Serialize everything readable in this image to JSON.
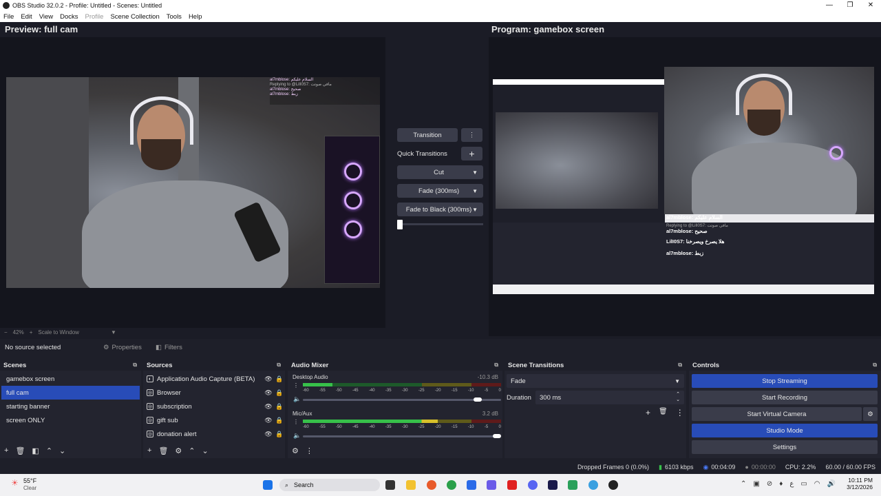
{
  "window": {
    "title": "OBS Studio 32.0.2 - Profile: Untitled - Scenes: Untitled",
    "controls": [
      "—",
      "❐",
      "✕"
    ]
  },
  "menu": [
    "File",
    "Edit",
    "View",
    "Docks",
    "Profile",
    "Scene Collection",
    "Tools",
    "Help"
  ],
  "preview": {
    "title": "Preview: full cam"
  },
  "program": {
    "title": "Program: gamebox screen"
  },
  "chat_preview": [
    "al7mblose: السلام عليكم",
    "Replying to @LilI0S7: مافي صوتت",
    "al7mblose: صحيح",
    "LilI0S7: هلا يصرخ ويصرخنا",
    "al7mblose: زبط"
  ],
  "transitions_panel": {
    "transition_label": "Transition",
    "quick_transitions_label": "Quick Transitions",
    "items": [
      "Cut",
      "Fade (300ms)",
      "Fade to Black (300ms)"
    ]
  },
  "zoom": {
    "value": "42%",
    "scale_mode": "Scale to Window"
  },
  "source_bar": {
    "status": "No source selected",
    "properties_label": "Properties",
    "filters_label": "Filters"
  },
  "scenes": {
    "title": "Scenes",
    "items": [
      "gamebox screen",
      "full cam",
      "starting banner",
      "screen ONLY"
    ],
    "selected_index": 1
  },
  "sources": {
    "title": "Sources",
    "items": [
      "Application Audio Capture (BETA)",
      "Browser",
      "subscription",
      "gift sub",
      "donation alert"
    ]
  },
  "audio_mixer": {
    "title": "Audio Mixer",
    "channels": [
      {
        "name": "Desktop Audio",
        "db": "-10.3 dB",
        "level": 0.15,
        "volume": 0.9
      },
      {
        "name": "Mic/Aux",
        "db": "3.2 dB",
        "level": 0.68,
        "volume": 1.0
      }
    ],
    "scale_labels": [
      "-60",
      "-55",
      "-50",
      "-45",
      "-40",
      "-35",
      "-30",
      "-25",
      "-20",
      "-15",
      "-10",
      "-5",
      "0"
    ]
  },
  "scene_transitions": {
    "title": "Scene Transitions",
    "selected": "Fade",
    "duration_label": "Duration",
    "duration_value": "300 ms"
  },
  "controls": {
    "title": "Controls",
    "buttons": [
      "Stop Streaming",
      "Start Recording",
      "Start Virtual Camera",
      "Studio Mode",
      "Settings"
    ]
  },
  "status": {
    "dropped_frames": "Dropped Frames 0 (0.0%)",
    "bitrate": "6103 kbps",
    "stream_time": "00:04:09",
    "rec_time": "00:00:00",
    "cpu": "CPU: 2.2%",
    "fps": "60.00 / 60.00 FPS"
  },
  "taskbar": {
    "weather_temp": "55°F",
    "weather_desc": "Clear",
    "search_label": "Search",
    "time": "10:11 PM",
    "date": "3/12/2026",
    "lang": "ع"
  },
  "colors": {
    "accent": "#284cb8",
    "dock_bg": "#23242f",
    "window_bg": "#1b1c26"
  }
}
